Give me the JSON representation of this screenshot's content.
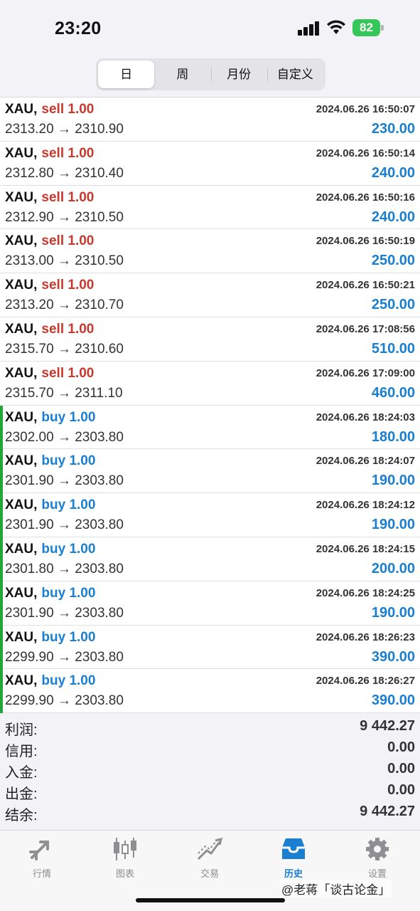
{
  "status_bar": {
    "time": "23:20",
    "battery": "82"
  },
  "period_tabs": [
    {
      "label": "日",
      "active": true
    },
    {
      "label": "周",
      "active": false
    },
    {
      "label": "月份",
      "active": false
    },
    {
      "label": "自定义",
      "active": false
    }
  ],
  "trades": [
    {
      "symbol": "XAU,",
      "side": "sell 1.00",
      "type": "sell",
      "datetime": "2024.06.26 16:50:07",
      "prices": "2313.20 → 2310.90",
      "profit": "230.00"
    },
    {
      "symbol": "XAU,",
      "side": "sell 1.00",
      "type": "sell",
      "datetime": "2024.06.26 16:50:14",
      "prices": "2312.80 → 2310.40",
      "profit": "240.00"
    },
    {
      "symbol": "XAU,",
      "side": "sell 1.00",
      "type": "sell",
      "datetime": "2024.06.26 16:50:16",
      "prices": "2312.90 → 2310.50",
      "profit": "240.00"
    },
    {
      "symbol": "XAU,",
      "side": "sell 1.00",
      "type": "sell",
      "datetime": "2024.06.26 16:50:19",
      "prices": "2313.00 → 2310.50",
      "profit": "250.00"
    },
    {
      "symbol": "XAU,",
      "side": "sell 1.00",
      "type": "sell",
      "datetime": "2024.06.26 16:50:21",
      "prices": "2313.20 → 2310.70",
      "profit": "250.00"
    },
    {
      "symbol": "XAU,",
      "side": "sell 1.00",
      "type": "sell",
      "datetime": "2024.06.26 17:08:56",
      "prices": "2315.70 → 2310.60",
      "profit": "510.00"
    },
    {
      "symbol": "XAU,",
      "side": "sell 1.00",
      "type": "sell",
      "datetime": "2024.06.26 17:09:00",
      "prices": "2315.70 → 2311.10",
      "profit": "460.00"
    },
    {
      "symbol": "XAU,",
      "side": "buy 1.00",
      "type": "buy",
      "datetime": "2024.06.26 18:24:03",
      "prices": "2302.00 → 2303.80",
      "profit": "180.00"
    },
    {
      "symbol": "XAU,",
      "side": "buy 1.00",
      "type": "buy",
      "datetime": "2024.06.26 18:24:07",
      "prices": "2301.90 → 2303.80",
      "profit": "190.00"
    },
    {
      "symbol": "XAU,",
      "side": "buy 1.00",
      "type": "buy",
      "datetime": "2024.06.26 18:24:12",
      "prices": "2301.90 → 2303.80",
      "profit": "190.00"
    },
    {
      "symbol": "XAU,",
      "side": "buy 1.00",
      "type": "buy",
      "datetime": "2024.06.26 18:24:15",
      "prices": "2301.80 → 2303.80",
      "profit": "200.00"
    },
    {
      "symbol": "XAU,",
      "side": "buy 1.00",
      "type": "buy",
      "datetime": "2024.06.26 18:24:25",
      "prices": "2301.90 → 2303.80",
      "profit": "190.00"
    },
    {
      "symbol": "XAU,",
      "side": "buy 1.00",
      "type": "buy",
      "datetime": "2024.06.26 18:26:23",
      "prices": "2299.90 → 2303.80",
      "profit": "390.00"
    },
    {
      "symbol": "XAU,",
      "side": "buy 1.00",
      "type": "buy",
      "datetime": "2024.06.26 18:26:27",
      "prices": "2299.90 → 2303.80",
      "profit": "390.00"
    }
  ],
  "summary": [
    {
      "label": "利润:",
      "value": "9 442.27"
    },
    {
      "label": "信用:",
      "value": "0.00"
    },
    {
      "label": "入金:",
      "value": "0.00"
    },
    {
      "label": "出金:",
      "value": "0.00"
    },
    {
      "label": "结余:",
      "value": "9 442.27"
    }
  ],
  "tabbar": [
    {
      "label": "行情",
      "icon": "quotes-arrows-icon",
      "active": false
    },
    {
      "label": "图表",
      "icon": "candlestick-chart-icon",
      "active": false
    },
    {
      "label": "交易",
      "icon": "trade-trend-icon",
      "active": false
    },
    {
      "label": "历史",
      "icon": "history-inbox-icon",
      "active": true
    },
    {
      "label": "设置",
      "icon": "gear-icon",
      "active": false
    }
  ],
  "watermark": "@老蒋「谈古论金」",
  "colors": {
    "sell": "#c8382d",
    "buy": "#1a7fd0",
    "buy_marker": "#22a63a",
    "battery": "#35c759"
  }
}
